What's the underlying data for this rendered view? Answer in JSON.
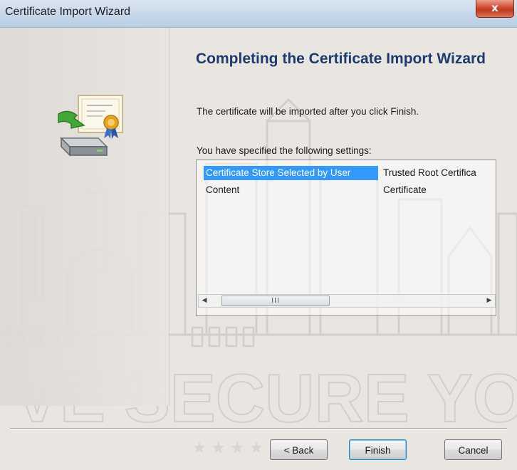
{
  "window": {
    "title": "Certificate Import Wizard",
    "close_label": "x"
  },
  "main": {
    "heading": "Completing the Certificate Import Wizard",
    "info_text": "The certificate will be imported after you click Finish.",
    "settings_label": "You have specified the following settings:"
  },
  "settings_list": {
    "rows": [
      {
        "name": "Certificate Store Selected by User",
        "value": "Trusted Root Certifica",
        "selected": true
      },
      {
        "name": "Content",
        "value": "Certificate",
        "selected": false
      }
    ],
    "scrollbar_grip": "III"
  },
  "buttons": {
    "back": "< Back",
    "finish": "Finish",
    "cancel": "Cancel"
  },
  "watermark": {
    "text": "VE SECURE YOUR L"
  },
  "icons": {
    "wizard_graphic": "certificate-import-icon",
    "close": "close-icon",
    "scroll_left": "scroll-left-icon",
    "scroll_right": "scroll-right-icon"
  },
  "colors": {
    "heading": "#1d3b6e",
    "selection": "#3399ff",
    "close_button": "#c03a1c"
  }
}
